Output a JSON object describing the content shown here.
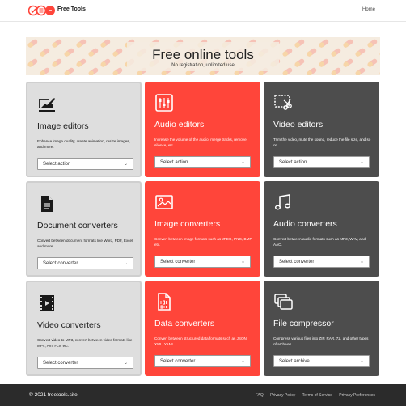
{
  "header": {
    "brand": "Free Tools",
    "home_label": "Home"
  },
  "hero": {
    "title": "Free online tools",
    "subtitle": "No registration, unlimited use"
  },
  "cards": [
    {
      "title": "Image editors",
      "desc": "Enhance image quality, create animation, resize images, and more.",
      "select": "Select action",
      "icon": "image-edit-icon",
      "style": "gray"
    },
    {
      "title": "Audio editors",
      "desc": "Increase the volume of the audio, merge tracks, remove silence, etc.",
      "select": "Select action",
      "icon": "equalizer-icon",
      "style": "red"
    },
    {
      "title": "Video editors",
      "desc": "Trim the video, mute the sound, reduce the file size, and so on.",
      "select": "Select action",
      "icon": "video-cut-icon",
      "style": "dark"
    },
    {
      "title": "Document converters",
      "desc": "Convert between document formats like Word, PDF, Excel, and more.",
      "select": "Select converter",
      "icon": "document-icon",
      "style": "gray"
    },
    {
      "title": "Image converters",
      "desc": "Convert between image formats such as JPEG, PNG, BMP, etc.",
      "select": "Select converter",
      "icon": "picture-icon",
      "style": "red"
    },
    {
      "title": "Audio converters",
      "desc": "Convert between audio formats such as MP3, WAV, and AAC.",
      "select": "Select converter",
      "icon": "music-note-icon",
      "style": "dark"
    },
    {
      "title": "Video converters",
      "desc": "Convert video to MP3, convert between video formats like MP4, AVI, FLV, etc.",
      "select": "Select converter",
      "icon": "film-icon",
      "style": "gray"
    },
    {
      "title": "Data converters",
      "desc": "Convert between structured data formats such as JSON, XML, YAML.",
      "select": "Select converter",
      "icon": "binary-file-icon",
      "style": "red"
    },
    {
      "title": "File compressor",
      "desc": "Compress various files into ZIP, RAR, 7Z, and other types of archives.",
      "select": "Select archive",
      "icon": "archive-icon",
      "style": "dark"
    }
  ],
  "footer": {
    "copyright": "© 2021 freetools.site",
    "links": [
      "FAQ",
      "Privacy Policy",
      "Terms of Service",
      "Privacy Preferences"
    ]
  },
  "colors": {
    "red": "#ff453a",
    "dark": "#4d4d4d",
    "gray": "#dedede",
    "footer": "#2b2b2b",
    "hero": "#f5ece0"
  }
}
